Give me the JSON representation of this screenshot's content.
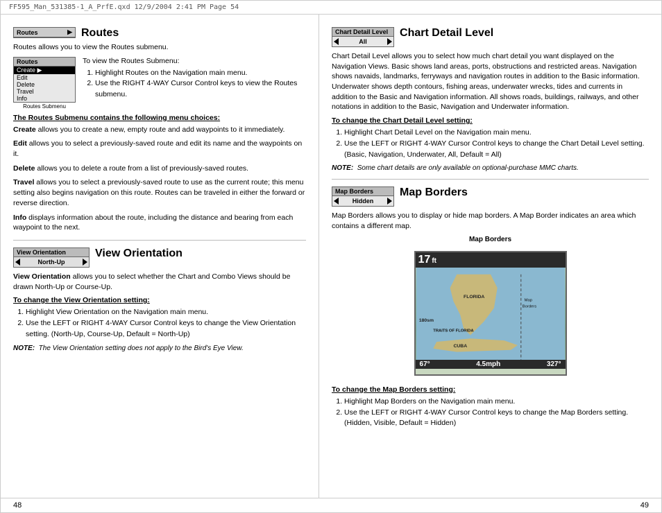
{
  "header": {
    "text": "FF595_Man_531385-1_A_PrfE.qxd   12/9/2004   2:41 PM   Page 54"
  },
  "left_page": {
    "page_number": "48",
    "routes_section": {
      "widget_label": "Routes",
      "widget_arrow": "▶",
      "section_title": "Routes",
      "desc": "Routes allows you to view the Routes submenu.",
      "submenu_title": "To view the Routes Submenu:",
      "submenu_widget_label": "Routes",
      "submenu_items": [
        "Create ▶",
        "Edit",
        "Delete",
        "Travel",
        "Info"
      ],
      "submenu_caption": "Routes Submenu",
      "steps": [
        "Highlight Routes on the Navigation main menu.",
        "Use the RIGHT 4-WAY Cursor Control keys to view the Routes submenu."
      ],
      "menu_choices_title": "The Routes Submenu contains the following menu choices:",
      "menu_choices": [
        {
          "term": "Create",
          "desc": "allows you to create a new, empty route and add waypoints to it immediately."
        },
        {
          "term": "Edit",
          "desc": "allows you to select a previously-saved route and edit its name and the waypoints on it."
        },
        {
          "term": "Delete",
          "desc": "allows you to delete a route from a list of previously-saved routes."
        },
        {
          "term": "Travel",
          "desc": "allows you to select a previously-saved route to use as the current route; this menu setting also begins navigation on this route. Routes can be traveled in either the forward or reverse direction."
        },
        {
          "term": "Info",
          "desc": "displays information about the route, including the distance and bearing from each waypoint to the next."
        }
      ]
    },
    "view_orientation_section": {
      "widget_label": "View Orientation",
      "widget_value": "North-Up",
      "section_title": "View Orientation",
      "desc": "View Orientation allows you to select whether the Chart and Combo Views should be drawn North-Up or Course-Up.",
      "change_title": "To change the View Orientation setting:",
      "steps": [
        "Highlight View Orientation on the Navigation main menu.",
        "Use the LEFT or RIGHT 4-WAY Cursor Control keys to change the View Orientation setting. (North-Up, Course-Up, Default = North-Up)"
      ],
      "note_label": "NOTE:",
      "note_text": "The View Orientation setting does not apply to the Bird's Eye View."
    }
  },
  "right_page": {
    "page_number": "49",
    "chart_detail_section": {
      "widget_label": "Chart Detail Level",
      "widget_value": "All",
      "section_title": "Chart Detail Level",
      "desc": "Chart Detail Level allows you to select how much chart detail you want displayed on the Navigation Views. Basic shows land areas, ports, obstructions and restricted areas. Navigation shows navaids, landmarks, ferryways and navigation routes in addition to the Basic information. Underwater shows depth contours, fishing areas, underwater wrecks, tides and currents in addition to the Basic and Navigation information. All shows roads, buildings, railways, and other notations in addition to the Basic, Navigation and Underwater information.",
      "change_title": "To change the Chart Detail Level setting:",
      "steps": [
        "Highlight Chart Detail Level on the Navigation main menu.",
        "Use the LEFT or RIGHT 4-WAY Cursor Control keys to change the Chart Detail Level setting. (Basic, Navigation, Underwater, All, Default = All)"
      ],
      "note_label": "NOTE:",
      "note_text": "Some chart details are only available on optional-purchase MMC charts."
    },
    "map_borders_section": {
      "widget_label": "Map Borders",
      "widget_value": "Hidden",
      "section_title": "Map Borders",
      "desc": "Map Borders allows you to display or hide map borders. A Map Border indicates an area which contains a different map.",
      "chart_title": "Map Borders",
      "chart_depth": "17",
      "chart_depth_unit": "ft",
      "chart_distance": "180sm",
      "chart_temp": "67°",
      "chart_speed": "4.5mph",
      "chart_heading": "327°",
      "map_label_line1": "Map",
      "map_label_line2": "Borders",
      "map_text_florida": "FLORIDA",
      "map_text_traits": "TRAITS OF FLORIDA",
      "map_text_cuba": "CUBA",
      "change_title": "To change the Map Borders setting:",
      "steps": [
        "Highlight Map Borders on the Navigation main menu.",
        "Use the LEFT or RIGHT 4-WAY Cursor Control keys to change the Map Borders setting. (Hidden, Visible, Default = Hidden)"
      ]
    }
  }
}
